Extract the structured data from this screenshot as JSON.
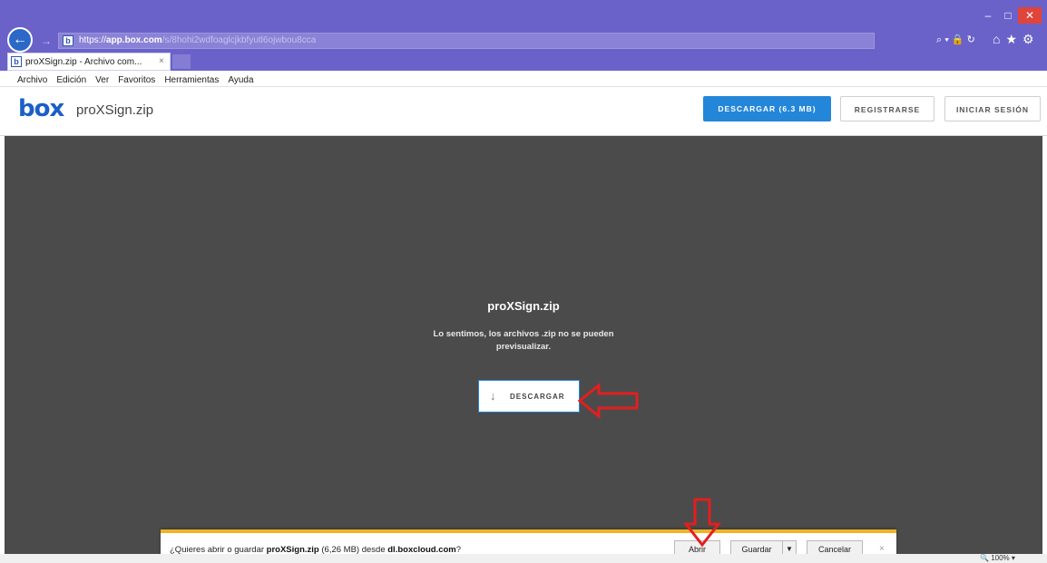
{
  "browser": {
    "window_controls": {
      "minimize": "–",
      "maximize": "□",
      "close": "✕"
    },
    "address": {
      "scheme": "https://",
      "host": "app.box.com",
      "path": "/s/8hohi2wdfoaglcjkbfyutl6ojwbou8cca"
    },
    "address_icons": "⌕ ▾ 🔒 ↻",
    "tab": {
      "title": "proXSign.zip - Archivo com...",
      "close": "×"
    },
    "menu": [
      "Archivo",
      "Edición",
      "Ver",
      "Favoritos",
      "Herramientas",
      "Ayuda"
    ]
  },
  "header": {
    "logo": "box",
    "filename": "proXSign.zip",
    "download_button": "DESCARGAR (6.3 MB)",
    "register_button": "REGISTRARSE",
    "login_button": "INICIAR SESIÓN"
  },
  "preview": {
    "title": "proXSign.zip",
    "message": "Lo sentimos, los archivos .zip no se pueden previsualizar.",
    "download_icon": "↓",
    "download_label": "DESCARGAR"
  },
  "notification": {
    "text_prefix": "¿Quieres abrir o guardar ",
    "file_name": "proXSign.zip",
    "text_middle": " (6,26 MB) desde ",
    "source": "dl.boxcloud.com",
    "text_suffix": "?",
    "open_button": "Abrir",
    "save_button": "Guardar",
    "save_dropdown": "▼",
    "cancel_button": "Cancelar",
    "close": "×"
  },
  "status": {
    "zoom": "100%"
  },
  "colors": {
    "chrome": "#6b62c9",
    "accent": "#2486d9",
    "preview_bg": "#4b4b4b",
    "annotation": "#e41e1e",
    "notification_border": "#f0b325"
  }
}
